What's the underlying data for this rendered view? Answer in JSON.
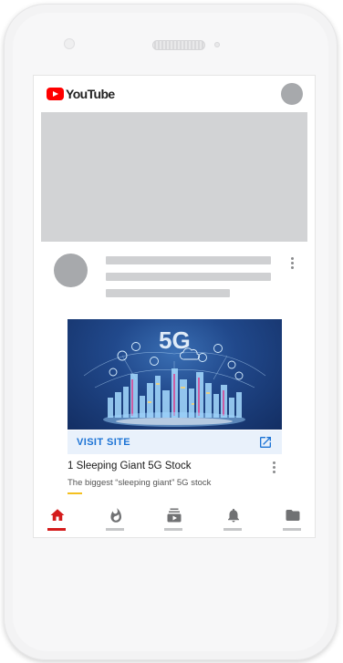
{
  "app": {
    "name": "YouTube"
  },
  "ad": {
    "cta": "VISIT SITE",
    "title": "1 Sleeping Giant 5G Stock",
    "description": "The biggest “sleeping giant” 5G stock",
    "image_text": "5G"
  },
  "nav": {
    "items": [
      {
        "icon": "home-icon",
        "active": true
      },
      {
        "icon": "trending-icon",
        "active": false
      },
      {
        "icon": "subscriptions-icon",
        "active": false
      },
      {
        "icon": "bell-icon",
        "active": false
      },
      {
        "icon": "library-icon",
        "active": false
      }
    ]
  },
  "colors": {
    "brand_red": "#ff0000",
    "active_red": "#d41c1c",
    "cta_blue": "#1c73d5",
    "placeholder_gray": "#d2d3d5",
    "badge_yellow": "#f4c020"
  }
}
